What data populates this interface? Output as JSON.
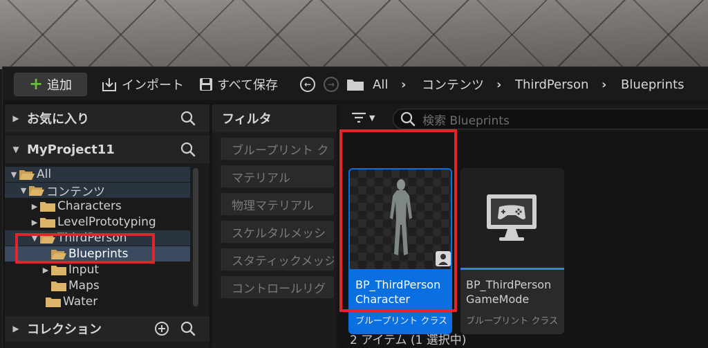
{
  "toolbar": {
    "add_label": "追加",
    "import_label": "インポート",
    "save_all_label": "すべて保存",
    "breadcrumb": [
      "All",
      "コンテンツ",
      "ThirdPerson",
      "Blueprints"
    ]
  },
  "left_panel": {
    "favorites_label": "お気に入り",
    "project_label": "MyProject11",
    "collections_label": "コレクション",
    "tree": [
      {
        "label": "All"
      },
      {
        "label": "コンテンツ"
      },
      {
        "label": "Characters"
      },
      {
        "label": "LevelPrototyping"
      },
      {
        "label": "ThirdPerson"
      },
      {
        "label": "Blueprints"
      },
      {
        "label": "Input"
      },
      {
        "label": "Maps"
      },
      {
        "label": "Water"
      }
    ]
  },
  "filter_panel": {
    "title": "フィルタ",
    "items": [
      "ブループリント ク",
      "マテリアル",
      "物理マテリアル",
      "スケルタルメッシ",
      "スタティックメッジ",
      "コントロールリグ"
    ]
  },
  "content": {
    "search_placeholder": "検索 Blueprints",
    "assets": [
      {
        "name_line1": "BP_ThirdPerson",
        "name_line2": "Character",
        "type": "ブループリント クラス",
        "selected": true
      },
      {
        "name_line1": "BP_ThirdPerson",
        "name_line2": "GameMode",
        "type": "ブループリント クラス",
        "selected": false
      }
    ],
    "status": "2 アイテム (1 選択中)"
  },
  "colors": {
    "accent_blue": "#0a6fe0",
    "highlight_red": "#e0262d",
    "add_green": "#6bbf3d",
    "folder": "#c9a057"
  }
}
